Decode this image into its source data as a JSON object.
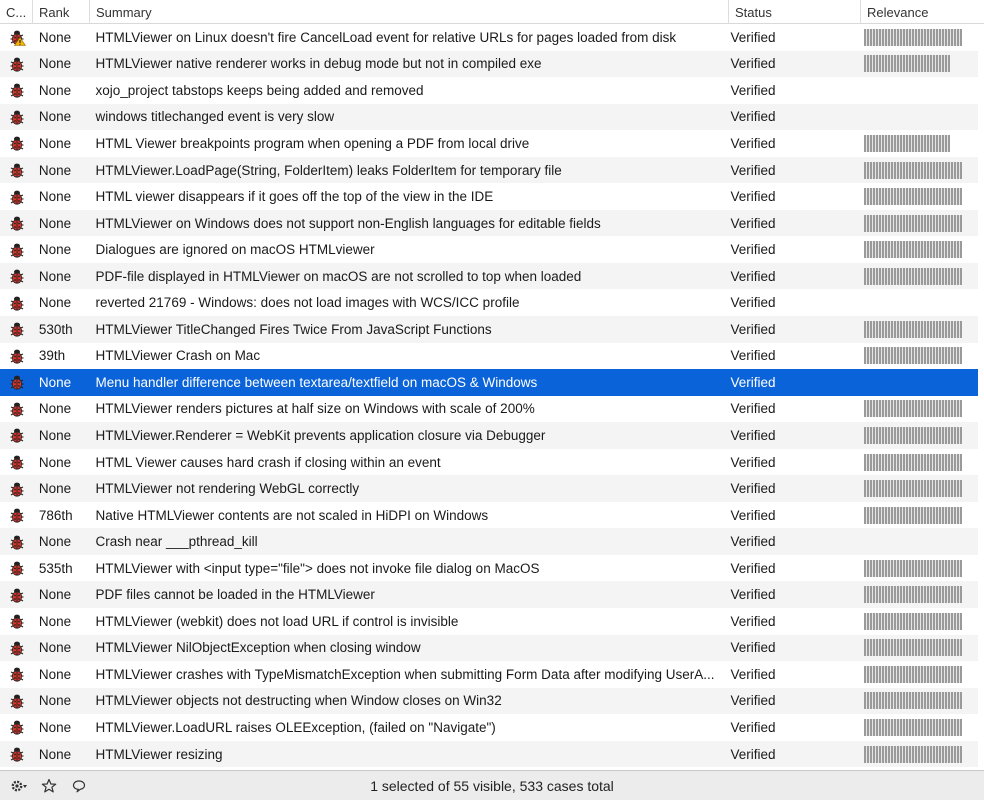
{
  "columns": {
    "category": "C...",
    "rank": "Rank",
    "summary": "Summary",
    "status": "Status",
    "relevance": "Relevance"
  },
  "rows": [
    {
      "rank": "None",
      "summary": "HTMLViewer on Linux doesn't fire CancelLoad event for relative URLs for pages loaded from disk",
      "status": "Verified",
      "relevance": 1.0,
      "icon": "bug-warning-icon"
    },
    {
      "rank": "None",
      "summary": "HTMLViewer native renderer works in debug mode but not in compiled exe",
      "status": "Verified",
      "relevance": 0.88,
      "icon": "ladybug-icon"
    },
    {
      "rank": "None",
      "summary": "xojo_project tabstops keeps being added and removed",
      "status": "Verified",
      "relevance": 0,
      "icon": "ladybug-icon"
    },
    {
      "rank": "None",
      "summary": "windows titlechanged event is very slow",
      "status": "Verified",
      "relevance": 0,
      "icon": "ladybug-icon"
    },
    {
      "rank": "None",
      "summary": "HTML Viewer breakpoints program when opening a PDF from local drive",
      "status": "Verified",
      "relevance": 0.88,
      "icon": "ladybug-icon"
    },
    {
      "rank": "None",
      "summary": "HTMLViewer.LoadPage(String, FolderItem) leaks FolderItem for temporary file",
      "status": "Verified",
      "relevance": 1.0,
      "icon": "ladybug-icon"
    },
    {
      "rank": "None",
      "summary": "HTML viewer disappears if it goes off the top of the view in the IDE",
      "status": "Verified",
      "relevance": 1.0,
      "icon": "ladybug-icon"
    },
    {
      "rank": "None",
      "summary": "HTMLViewer on Windows does not support non-English languages for editable fields",
      "status": "Verified",
      "relevance": 1.0,
      "icon": "ladybug-icon"
    },
    {
      "rank": "None",
      "summary": "Dialogues are ignored on macOS HTMLviewer",
      "status": "Verified",
      "relevance": 1.0,
      "icon": "ladybug-icon"
    },
    {
      "rank": "None",
      "summary": "PDF-file displayed in HTMLViewer on macOS are not scrolled to top when loaded",
      "status": "Verified",
      "relevance": 1.0,
      "icon": "ladybug-icon"
    },
    {
      "rank": "None",
      "summary": "reverted 21769 - Windows: does not load images with WCS/ICC profile",
      "status": "Verified",
      "relevance": 0,
      "icon": "ladybug-icon"
    },
    {
      "rank": "530th",
      "summary": "HTMLViewer TitleChanged Fires Twice From JavaScript Functions",
      "status": "Verified",
      "relevance": 1.0,
      "icon": "ladybug-icon"
    },
    {
      "rank": "39th",
      "summary": "HTMLViewer Crash on Mac",
      "status": "Verified",
      "relevance": 1.0,
      "icon": "ladybug-icon"
    },
    {
      "rank": "None",
      "summary": "Menu handler difference between textarea/textfield on macOS & Windows",
      "status": "Verified",
      "relevance": 0,
      "icon": "ladybug-icon",
      "selected": true
    },
    {
      "rank": "None",
      "summary": "HTMLViewer renders pictures at half size on Windows with scale of 200%",
      "status": "Verified",
      "relevance": 1.0,
      "icon": "ladybug-icon"
    },
    {
      "rank": "None",
      "summary": "HTMLViewer.Renderer = WebKit prevents application closure via Debugger",
      "status": "Verified",
      "relevance": 1.0,
      "icon": "ladybug-icon"
    },
    {
      "rank": "None",
      "summary": "HTML Viewer causes hard crash if closing within an event",
      "status": "Verified",
      "relevance": 1.0,
      "icon": "ladybug-icon"
    },
    {
      "rank": "None",
      "summary": "HTMLViewer not rendering WebGL correctly",
      "status": "Verified",
      "relevance": 1.0,
      "icon": "ladybug-icon"
    },
    {
      "rank": "786th",
      "summary": "Native HTMLViewer contents are not scaled in HiDPI on Windows",
      "status": "Verified",
      "relevance": 1.0,
      "icon": "ladybug-icon"
    },
    {
      "rank": "None",
      "summary": "Crash near ___pthread_kill",
      "status": "Verified",
      "relevance": 0,
      "icon": "ladybug-icon"
    },
    {
      "rank": "535th",
      "summary": "HTMLViewer with <input type=\"file\"> does not invoke file dialog on MacOS",
      "status": "Verified",
      "relevance": 1.0,
      "icon": "ladybug-icon"
    },
    {
      "rank": "None",
      "summary": "PDF files cannot be loaded in the HTMLViewer",
      "status": "Verified",
      "relevance": 1.0,
      "icon": "ladybug-icon"
    },
    {
      "rank": "None",
      "summary": "HTMLViewer (webkit) does not load URL if control is invisible",
      "status": "Verified",
      "relevance": 1.0,
      "icon": "ladybug-icon"
    },
    {
      "rank": "None",
      "summary": "HTMLViewer NilObjectException when closing window",
      "status": "Verified",
      "relevance": 1.0,
      "icon": "ladybug-icon"
    },
    {
      "rank": "None",
      "summary": "HTMLViewer crashes with TypeMismatchException when submitting Form Data after modifying UserA...",
      "status": "Verified",
      "relevance": 1.0,
      "icon": "ladybug-icon"
    },
    {
      "rank": "None",
      "summary": "HTMLViewer objects not destructing when Window closes on Win32",
      "status": "Verified",
      "relevance": 1.0,
      "icon": "ladybug-icon"
    },
    {
      "rank": "None",
      "summary": "HTMLViewer.LoadURL raises OLEException, (failed on \"Navigate\")",
      "status": "Verified",
      "relevance": 1.0,
      "icon": "ladybug-icon"
    },
    {
      "rank": "None",
      "summary": "HTMLViewer resizing",
      "status": "Verified",
      "relevance": 1.0,
      "icon": "ladybug-icon"
    }
  ],
  "footer": {
    "status": "1 selected of 55 visible, 533 cases total",
    "icons": [
      "gear-icon",
      "star-icon",
      "comment-icon"
    ]
  },
  "colors": {
    "selection": "#0a63d8",
    "stripe": "#f4f4f5",
    "bug_red": "#d8352b"
  }
}
